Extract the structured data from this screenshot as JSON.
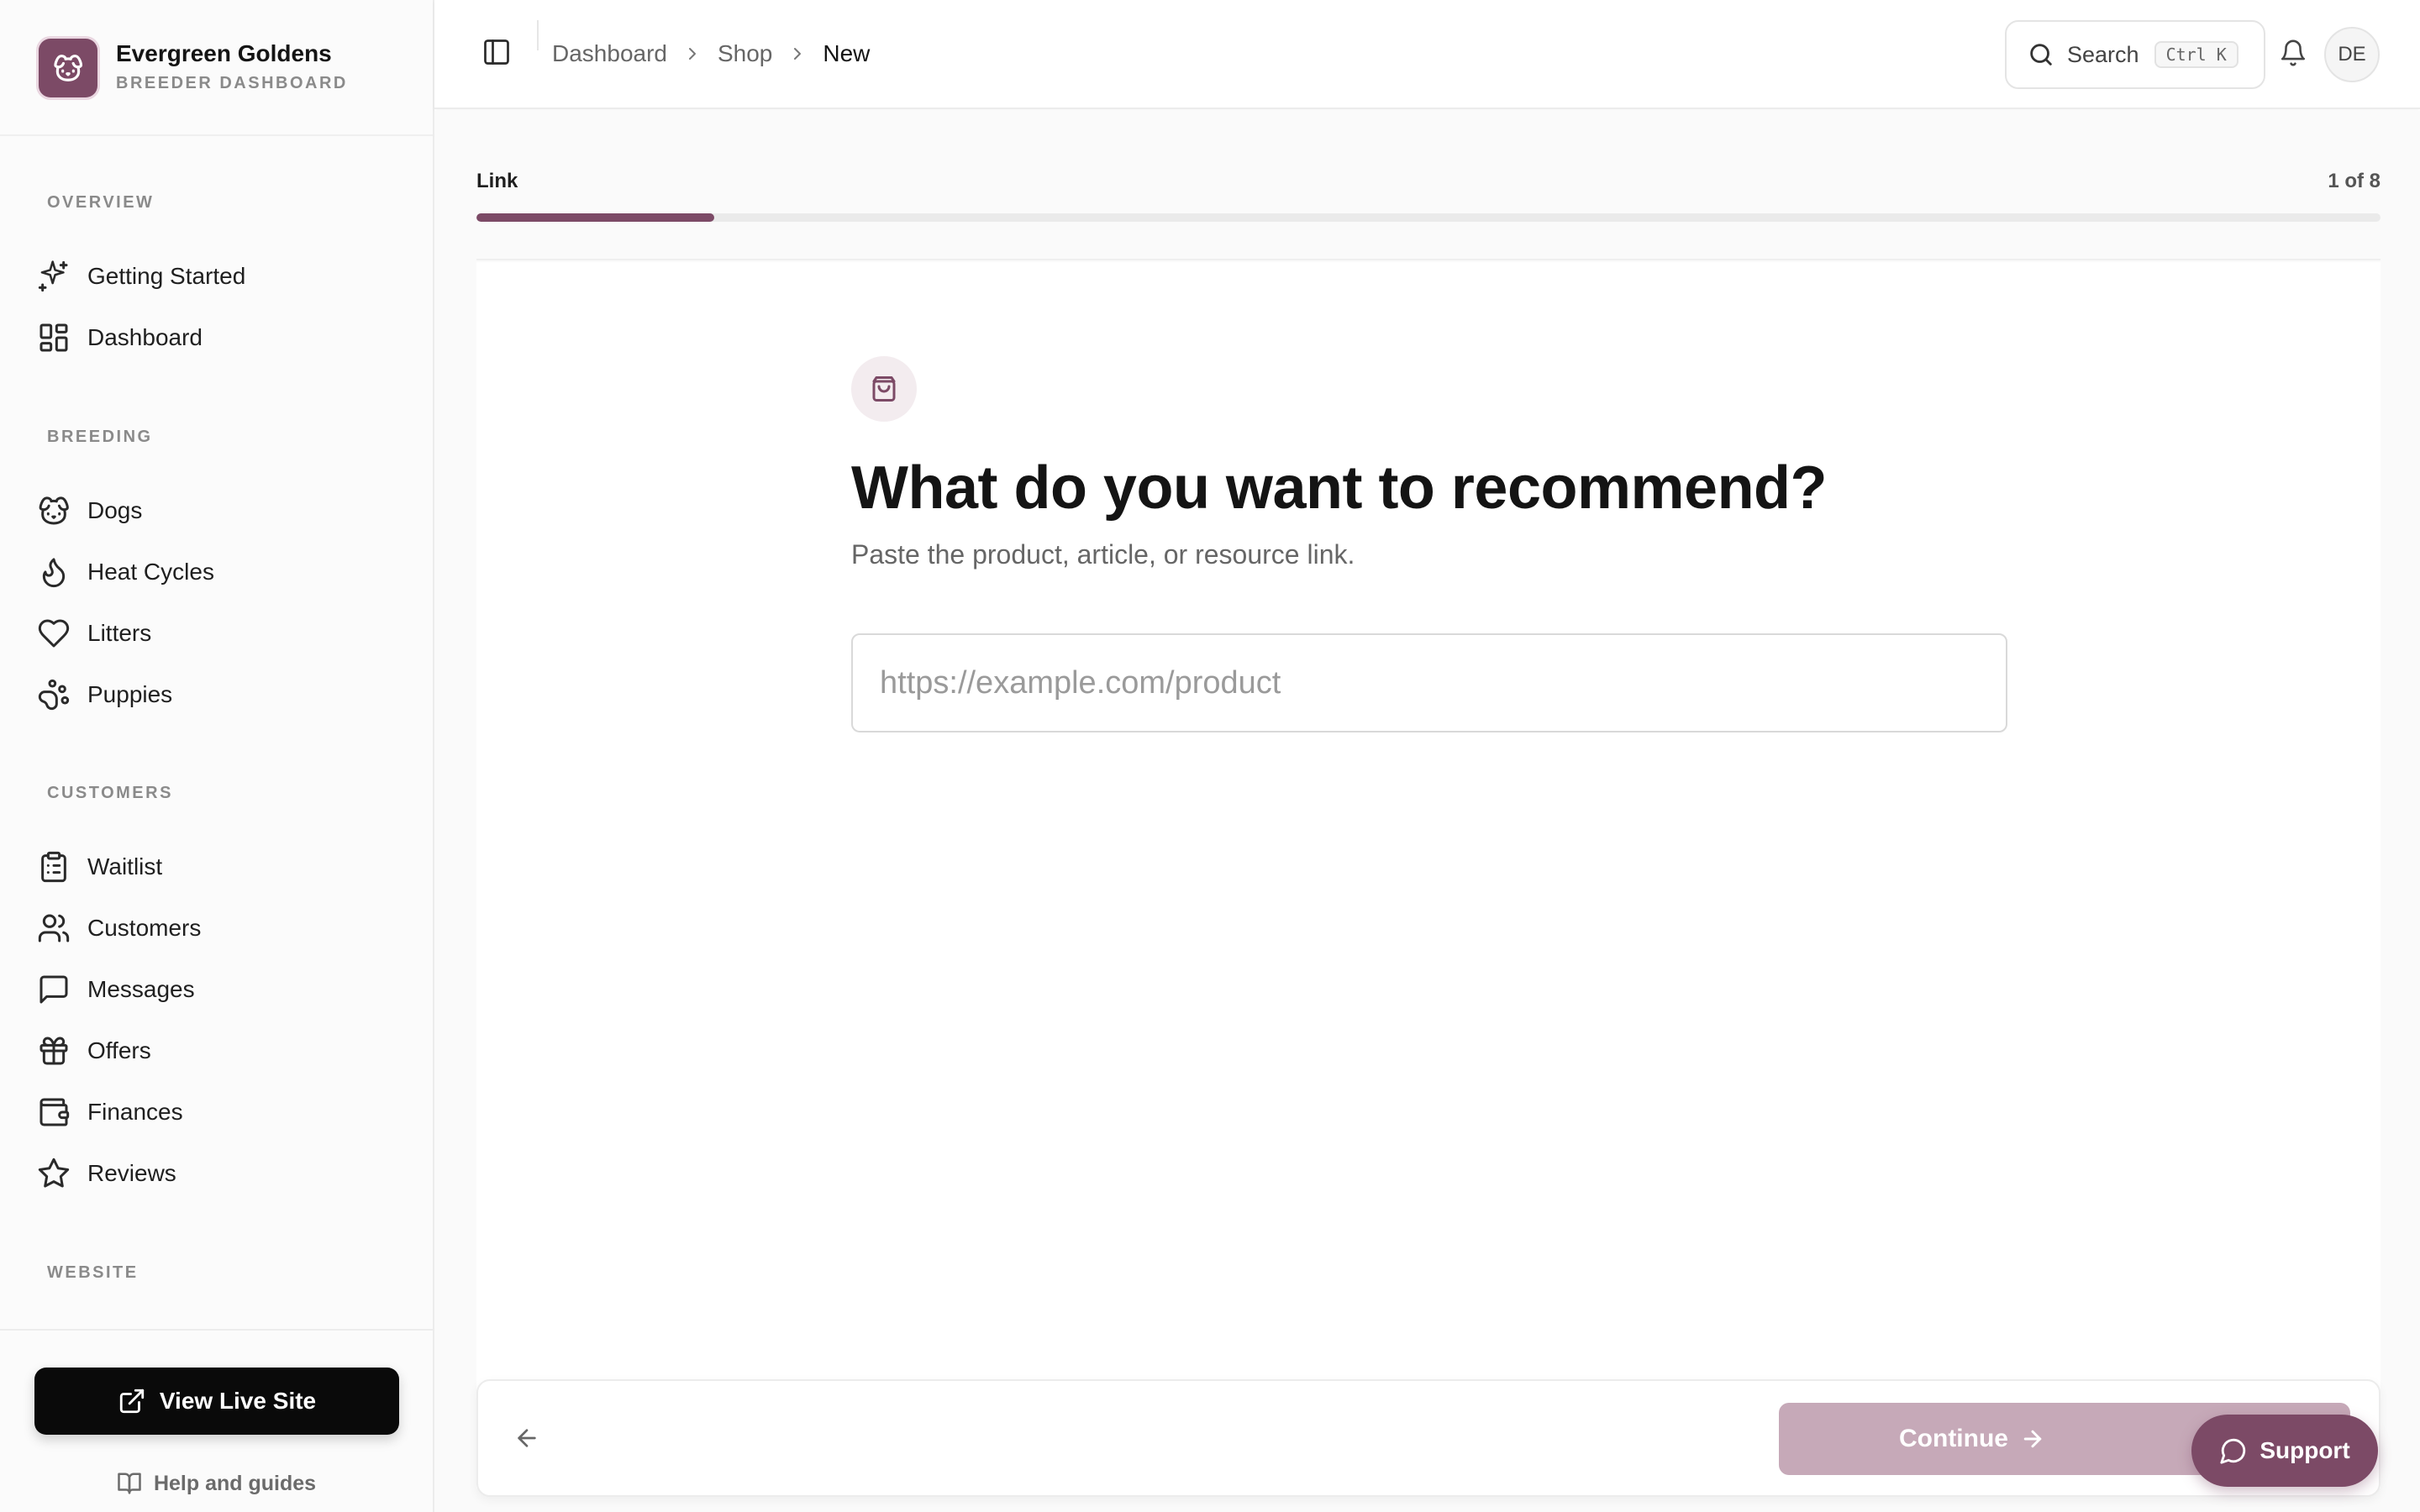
{
  "brand": {
    "name": "Evergreen Goldens",
    "subtitle": "BREEDER DASHBOARD",
    "logo_icon": "dog-icon",
    "accent": "#7c4a66"
  },
  "sidebar": {
    "sections": [
      {
        "label": "OVERVIEW",
        "items": [
          {
            "label": "Getting Started",
            "icon": "sparkles-icon"
          },
          {
            "label": "Dashboard",
            "icon": "layout-grid-icon"
          }
        ]
      },
      {
        "label": "BREEDING",
        "items": [
          {
            "label": "Dogs",
            "icon": "dog-icon"
          },
          {
            "label": "Heat Cycles",
            "icon": "flame-icon"
          },
          {
            "label": "Litters",
            "icon": "heart-icon"
          },
          {
            "label": "Puppies",
            "icon": "paw-icon"
          }
        ]
      },
      {
        "label": "CUSTOMERS",
        "items": [
          {
            "label": "Waitlist",
            "icon": "clipboard-list-icon"
          },
          {
            "label": "Customers",
            "icon": "users-icon"
          },
          {
            "label": "Messages",
            "icon": "message-square-icon"
          },
          {
            "label": "Offers",
            "icon": "gift-icon"
          },
          {
            "label": "Finances",
            "icon": "wallet-icon"
          },
          {
            "label": "Reviews",
            "icon": "star-icon"
          }
        ]
      },
      {
        "label": "WEBSITE",
        "items": []
      }
    ],
    "view_live_site": "View Live Site",
    "help_and_guides": "Help and guides"
  },
  "header": {
    "breadcrumb": [
      "Dashboard",
      "Shop",
      "New"
    ],
    "search_label": "Search",
    "search_shortcut": "Ctrl K",
    "avatar_initials": "DE"
  },
  "wizard": {
    "step_label": "Link",
    "step_count": "1 of 8",
    "progress": 0.125,
    "icon": "shopping-bag-icon",
    "title": "What do you want to recommend?",
    "subtitle": "Paste the product, article, or resource link.",
    "url_input": {
      "value": "",
      "placeholder": "https://example.com/product"
    },
    "continue_label": "Continue",
    "continue_color": "#c6a9b8"
  },
  "support_label": "Support"
}
